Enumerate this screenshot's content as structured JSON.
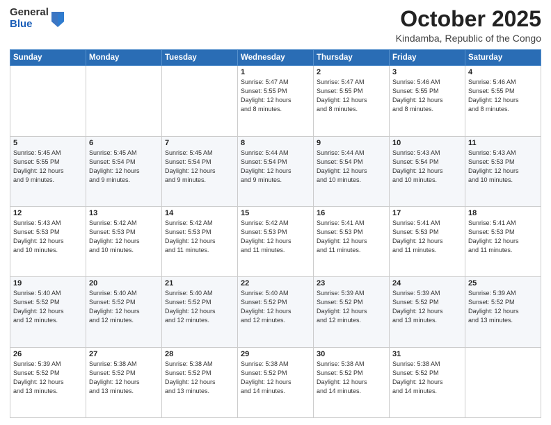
{
  "header": {
    "logo": {
      "line1": "General",
      "line2": "Blue"
    },
    "title": "October 2025",
    "location": "Kindamba, Republic of the Congo"
  },
  "weekdays": [
    "Sunday",
    "Monday",
    "Tuesday",
    "Wednesday",
    "Thursday",
    "Friday",
    "Saturday"
  ],
  "weeks": [
    [
      {
        "day": "",
        "info": ""
      },
      {
        "day": "",
        "info": ""
      },
      {
        "day": "",
        "info": ""
      },
      {
        "day": "1",
        "info": "Sunrise: 5:47 AM\nSunset: 5:55 PM\nDaylight: 12 hours\nand 8 minutes."
      },
      {
        "day": "2",
        "info": "Sunrise: 5:47 AM\nSunset: 5:55 PM\nDaylight: 12 hours\nand 8 minutes."
      },
      {
        "day": "3",
        "info": "Sunrise: 5:46 AM\nSunset: 5:55 PM\nDaylight: 12 hours\nand 8 minutes."
      },
      {
        "day": "4",
        "info": "Sunrise: 5:46 AM\nSunset: 5:55 PM\nDaylight: 12 hours\nand 8 minutes."
      }
    ],
    [
      {
        "day": "5",
        "info": "Sunrise: 5:45 AM\nSunset: 5:55 PM\nDaylight: 12 hours\nand 9 minutes."
      },
      {
        "day": "6",
        "info": "Sunrise: 5:45 AM\nSunset: 5:54 PM\nDaylight: 12 hours\nand 9 minutes."
      },
      {
        "day": "7",
        "info": "Sunrise: 5:45 AM\nSunset: 5:54 PM\nDaylight: 12 hours\nand 9 minutes."
      },
      {
        "day": "8",
        "info": "Sunrise: 5:44 AM\nSunset: 5:54 PM\nDaylight: 12 hours\nand 9 minutes."
      },
      {
        "day": "9",
        "info": "Sunrise: 5:44 AM\nSunset: 5:54 PM\nDaylight: 12 hours\nand 10 minutes."
      },
      {
        "day": "10",
        "info": "Sunrise: 5:43 AM\nSunset: 5:54 PM\nDaylight: 12 hours\nand 10 minutes."
      },
      {
        "day": "11",
        "info": "Sunrise: 5:43 AM\nSunset: 5:53 PM\nDaylight: 12 hours\nand 10 minutes."
      }
    ],
    [
      {
        "day": "12",
        "info": "Sunrise: 5:43 AM\nSunset: 5:53 PM\nDaylight: 12 hours\nand 10 minutes."
      },
      {
        "day": "13",
        "info": "Sunrise: 5:42 AM\nSunset: 5:53 PM\nDaylight: 12 hours\nand 10 minutes."
      },
      {
        "day": "14",
        "info": "Sunrise: 5:42 AM\nSunset: 5:53 PM\nDaylight: 12 hours\nand 11 minutes."
      },
      {
        "day": "15",
        "info": "Sunrise: 5:42 AM\nSunset: 5:53 PM\nDaylight: 12 hours\nand 11 minutes."
      },
      {
        "day": "16",
        "info": "Sunrise: 5:41 AM\nSunset: 5:53 PM\nDaylight: 12 hours\nand 11 minutes."
      },
      {
        "day": "17",
        "info": "Sunrise: 5:41 AM\nSunset: 5:53 PM\nDaylight: 12 hours\nand 11 minutes."
      },
      {
        "day": "18",
        "info": "Sunrise: 5:41 AM\nSunset: 5:53 PM\nDaylight: 12 hours\nand 11 minutes."
      }
    ],
    [
      {
        "day": "19",
        "info": "Sunrise: 5:40 AM\nSunset: 5:52 PM\nDaylight: 12 hours\nand 12 minutes."
      },
      {
        "day": "20",
        "info": "Sunrise: 5:40 AM\nSunset: 5:52 PM\nDaylight: 12 hours\nand 12 minutes."
      },
      {
        "day": "21",
        "info": "Sunrise: 5:40 AM\nSunset: 5:52 PM\nDaylight: 12 hours\nand 12 minutes."
      },
      {
        "day": "22",
        "info": "Sunrise: 5:40 AM\nSunset: 5:52 PM\nDaylight: 12 hours\nand 12 minutes."
      },
      {
        "day": "23",
        "info": "Sunrise: 5:39 AM\nSunset: 5:52 PM\nDaylight: 12 hours\nand 12 minutes."
      },
      {
        "day": "24",
        "info": "Sunrise: 5:39 AM\nSunset: 5:52 PM\nDaylight: 12 hours\nand 13 minutes."
      },
      {
        "day": "25",
        "info": "Sunrise: 5:39 AM\nSunset: 5:52 PM\nDaylight: 12 hours\nand 13 minutes."
      }
    ],
    [
      {
        "day": "26",
        "info": "Sunrise: 5:39 AM\nSunset: 5:52 PM\nDaylight: 12 hours\nand 13 minutes."
      },
      {
        "day": "27",
        "info": "Sunrise: 5:38 AM\nSunset: 5:52 PM\nDaylight: 12 hours\nand 13 minutes."
      },
      {
        "day": "28",
        "info": "Sunrise: 5:38 AM\nSunset: 5:52 PM\nDaylight: 12 hours\nand 13 minutes."
      },
      {
        "day": "29",
        "info": "Sunrise: 5:38 AM\nSunset: 5:52 PM\nDaylight: 12 hours\nand 14 minutes."
      },
      {
        "day": "30",
        "info": "Sunrise: 5:38 AM\nSunset: 5:52 PM\nDaylight: 12 hours\nand 14 minutes."
      },
      {
        "day": "31",
        "info": "Sunrise: 5:38 AM\nSunset: 5:52 PM\nDaylight: 12 hours\nand 14 minutes."
      },
      {
        "day": "",
        "info": ""
      }
    ]
  ]
}
